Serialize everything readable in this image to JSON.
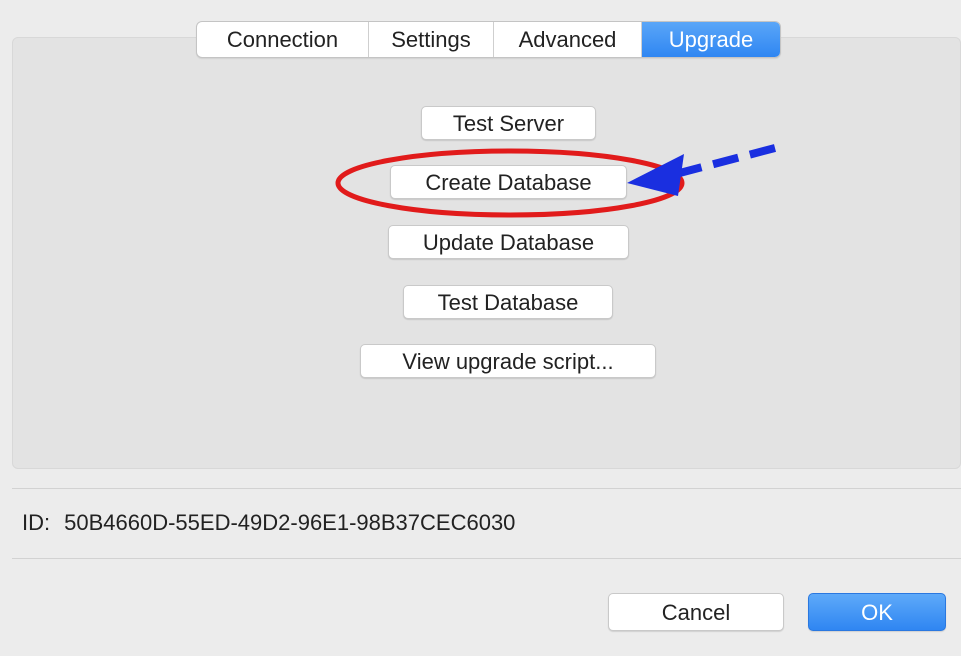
{
  "tabs": [
    {
      "label": "Connection",
      "active": false
    },
    {
      "label": "Settings",
      "active": false
    },
    {
      "label": "Advanced",
      "active": false
    },
    {
      "label": "Upgrade",
      "active": true
    }
  ],
  "upgrade": {
    "test_server": "Test Server",
    "create_database": "Create Database",
    "update_database": "Update Database",
    "test_database": "Test Database",
    "view_script": "View upgrade script..."
  },
  "id_row": {
    "label": "ID:",
    "value": "50B4660D-55ED-49D2-96E1-98B37CEC6030"
  },
  "footer": {
    "cancel": "Cancel",
    "ok": "OK"
  },
  "colors": {
    "accent": "#2f86f2",
    "highlight_ellipse": "#e11b1b",
    "annotation_arrow": "#1a2fe0"
  }
}
